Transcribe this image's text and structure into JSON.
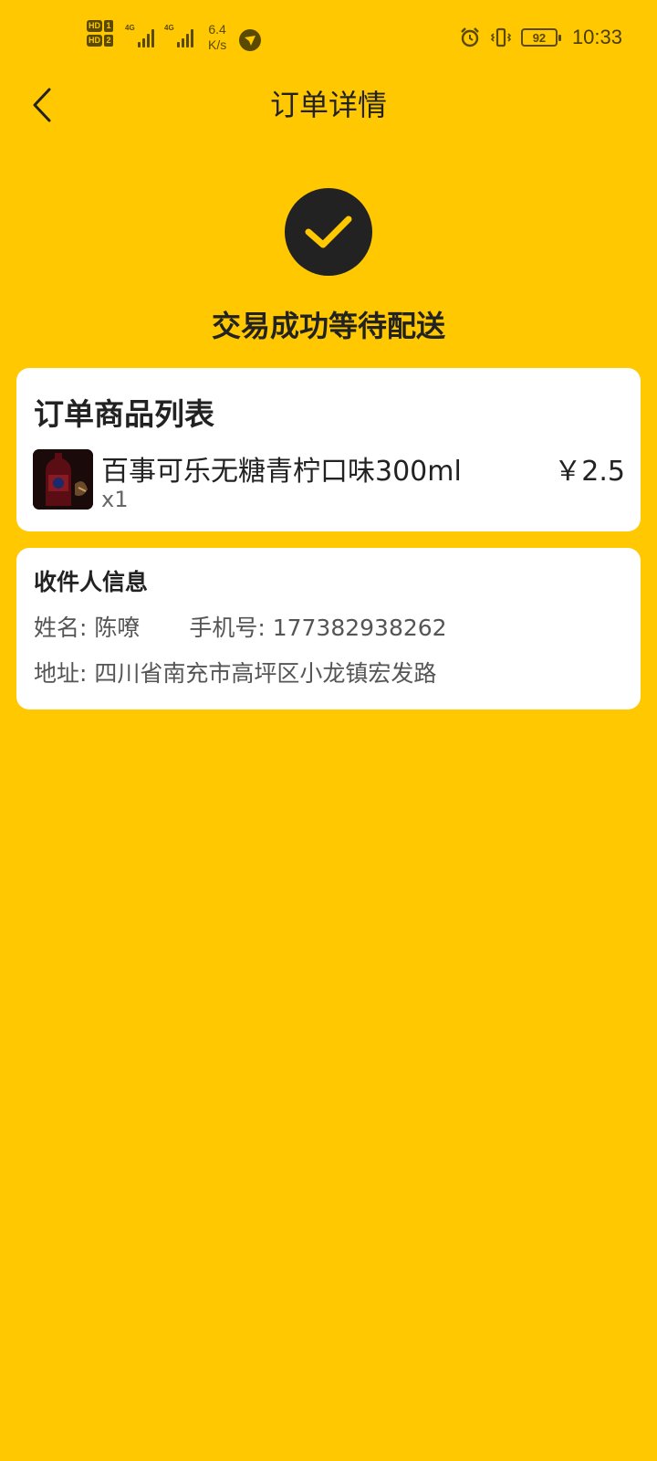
{
  "status_bar": {
    "sim1_badge": "HD",
    "sim1_num": "1",
    "sim2_badge": "HD",
    "sim2_num": "2",
    "network1": "4G",
    "network2": "4G",
    "speed_value": "6.4",
    "speed_unit": "K/s",
    "battery": "92",
    "time": "10:33",
    "icons": [
      "alarm-icon",
      "vibrate-icon",
      "battery-icon"
    ]
  },
  "header": {
    "title": "订单详情"
  },
  "status": {
    "text": "交易成功等待配送"
  },
  "goods": {
    "title": "订单商品列表",
    "items": [
      {
        "name": "百事可乐无糖青柠口味300ml",
        "quantity": "x1",
        "price": "￥2.5"
      }
    ]
  },
  "receiver": {
    "title": "收件人信息",
    "name_label": "姓名:",
    "name": "陈嘹",
    "phone_label": "手机号:",
    "phone": "177382938262",
    "address_label": "地址:",
    "address": "四川省南充市高坪区小龙镇宏发路"
  },
  "colors": {
    "background": "#FFC800",
    "card": "#FFFFFF",
    "dark": "#222222"
  }
}
